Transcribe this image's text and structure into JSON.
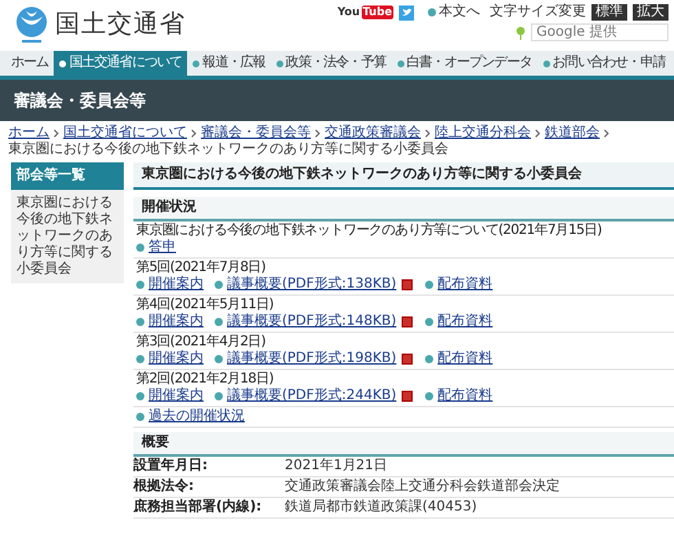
{
  "header": {
    "logo_text": "国土交通省",
    "video_logo": {
      "text": "You",
      "badge": "Tube"
    },
    "skip_link": "本文へ",
    "font_size_label": "文字サイズ変更",
    "font_size_buttons": [
      "標準",
      "拡大"
    ],
    "search": {
      "placeholder": "Google 提供"
    }
  },
  "nav": [
    {
      "label": "ホーム",
      "selected": false,
      "bullet": false
    },
    {
      "label": "国土交通省について",
      "selected": true,
      "bullet": true
    },
    {
      "label": "報道・広報",
      "selected": false,
      "bullet": true
    },
    {
      "label": "政策・法令・予算",
      "selected": false,
      "bullet": true
    },
    {
      "label": "白書・オープンデータ",
      "selected": false,
      "bullet": true
    },
    {
      "label": "お問い合わせ・申請",
      "selected": false,
      "bullet": true
    }
  ],
  "band_title": "審議会・委員会等",
  "breadcrumb": [
    {
      "label": "ホーム",
      "link": true
    },
    {
      "label": "国土交通省について",
      "link": true
    },
    {
      "label": "審議会・委員会等",
      "link": true
    },
    {
      "label": "交通政策審議会",
      "link": true
    },
    {
      "label": "陸上交通分科会",
      "link": true
    },
    {
      "label": "鉄道部会",
      "link": true
    },
    {
      "label": "東京圏における今後の地下鉄ネットワークのあり方等に関する小委員会",
      "link": false
    }
  ],
  "sidebar": {
    "heading": "部会等一覧",
    "items": [
      "東京圏における今後の地下鉄ネットワークのあり方等に関する小委員会"
    ]
  },
  "page_title": "東京圏における今後の地下鉄ネットワークのあり方等に関する小委員会",
  "status_section": {
    "heading": "開催状況",
    "entries": [
      {
        "title": "東京圏における今後の地下鉄ネットワークのあり方等について(2021年7月15日)",
        "links": [
          {
            "label": "答申",
            "pdf": false
          }
        ]
      },
      {
        "title": "第5回(2021年7月8日)",
        "links": [
          {
            "label": "開催案内",
            "pdf": false
          },
          {
            "label": "議事概要(PDF形式:138KB)",
            "pdf": true
          },
          {
            "label": "配布資料",
            "pdf": false
          }
        ]
      },
      {
        "title": "第4回(2021年5月11日)",
        "links": [
          {
            "label": "開催案内",
            "pdf": false
          },
          {
            "label": "議事概要(PDF形式:148KB)",
            "pdf": true
          },
          {
            "label": "配布資料",
            "pdf": false
          }
        ]
      },
      {
        "title": "第3回(2021年4月2日)",
        "links": [
          {
            "label": "開催案内",
            "pdf": false
          },
          {
            "label": "議事概要(PDF形式:198KB)",
            "pdf": true
          },
          {
            "label": "配布資料",
            "pdf": false
          }
        ]
      },
      {
        "title": "第2回(2021年2月18日)",
        "links": [
          {
            "label": "開催案内",
            "pdf": false
          },
          {
            "label": "議事概要(PDF形式:244KB)",
            "pdf": true
          },
          {
            "label": "配布資料",
            "pdf": false
          }
        ]
      },
      {
        "links": [
          {
            "label": "過去の開催状況",
            "pdf": false
          }
        ]
      }
    ]
  },
  "overview_section": {
    "heading": "概要",
    "rows": [
      {
        "label": "設置年月日:",
        "value": "2021年1月21日"
      },
      {
        "label": "根拠法令:",
        "value": "交通政策審議会陸上交通分科会鉄道部会決定"
      },
      {
        "label": "庶務担当部署(内線):",
        "value": "鉄道局都市鉄道政策課(40453)"
      }
    ]
  }
}
